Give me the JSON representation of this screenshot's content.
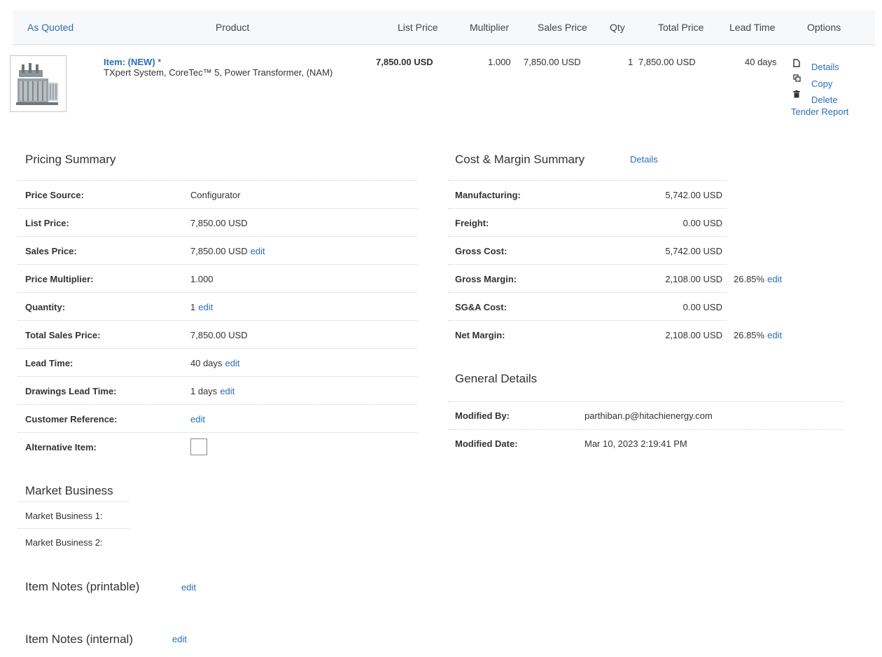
{
  "header": {
    "as_quoted": "As Quoted",
    "product": "Product",
    "list_price": "List Price",
    "multiplier": "Multiplier",
    "sales_price": "Sales Price",
    "qty": "Qty",
    "total_price": "Total Price",
    "lead_time": "Lead Time",
    "options": "Options"
  },
  "item": {
    "title_prefix": "Item: (NEW)",
    "title_suffix": " *",
    "description": "TXpert System, CoreTec™ 5, Power Transformer, (NAM)",
    "list_price": "7,850.00 USD",
    "multiplier": "1.000",
    "sales_price": "7,850.00 USD",
    "qty": "1",
    "total_price": "7,850.00 USD",
    "lead_time": "40 days",
    "options": {
      "details": "Details",
      "copy": "Copy",
      "delete": "Delete",
      "tender_report": "Tender Report"
    }
  },
  "pricing_summary": {
    "title": "Pricing Summary",
    "rows": [
      {
        "label": "Price Source:",
        "value": "Configurator",
        "edit": ""
      },
      {
        "label": "List Price:",
        "value": "7,850.00 USD",
        "edit": ""
      },
      {
        "label": "Sales Price:",
        "value": "7,850.00 USD",
        "edit": "edit"
      },
      {
        "label": "Price Multiplier:",
        "value": "1.000",
        "edit": ""
      },
      {
        "label": "Quantity:",
        "value": "1",
        "edit": "edit"
      },
      {
        "label": "Total Sales Price:",
        "value": "7,850.00 USD",
        "edit": ""
      },
      {
        "label": "Lead Time:",
        "value": "40 days",
        "edit": "edit"
      },
      {
        "label": "Drawings Lead Time:",
        "value": "1 days",
        "edit": "edit"
      },
      {
        "label": "Customer Reference:",
        "value": "",
        "edit": "edit"
      },
      {
        "label": "Alternative Item:",
        "value": "",
        "edit": ""
      }
    ]
  },
  "cost_margin": {
    "title": "Cost & Margin Summary",
    "details_link": "Details",
    "rows": [
      {
        "label": "Manufacturing:",
        "value": "5,742.00 USD",
        "pct": "",
        "edit": ""
      },
      {
        "label": "Freight:",
        "value": "0.00 USD",
        "pct": "",
        "edit": ""
      },
      {
        "label": "Gross Cost:",
        "value": "5,742.00 USD",
        "pct": "",
        "edit": ""
      },
      {
        "label": "Gross Margin:",
        "value": "2,108.00 USD",
        "pct": "26.85%",
        "edit": "edit"
      },
      {
        "label": "SG&A Cost:",
        "value": "0.00 USD",
        "pct": "",
        "edit": ""
      },
      {
        "label": "Net Margin:",
        "value": "2,108.00 USD",
        "pct": "26.85%",
        "edit": "edit"
      }
    ]
  },
  "general_details": {
    "title": "General Details",
    "rows": [
      {
        "label": "Modified By:",
        "value": "parthiban.p@hitachienergy.com"
      },
      {
        "label": "Modified Date:",
        "value": "Mar 10, 2023 2:19:41 PM"
      }
    ]
  },
  "market_business": {
    "title": "Market Business",
    "rows": [
      "Market Business 1:",
      "Market Business 2:"
    ]
  },
  "notes": {
    "printable_title": "Item Notes (printable)",
    "printable_edit": "edit",
    "internal_title": "Item Notes (internal)",
    "internal_edit": "edit"
  },
  "icons": {
    "product_thumbnail": "power-transformer-image",
    "details": "document-icon",
    "copy": "copy-icon",
    "delete": "trash-icon"
  }
}
